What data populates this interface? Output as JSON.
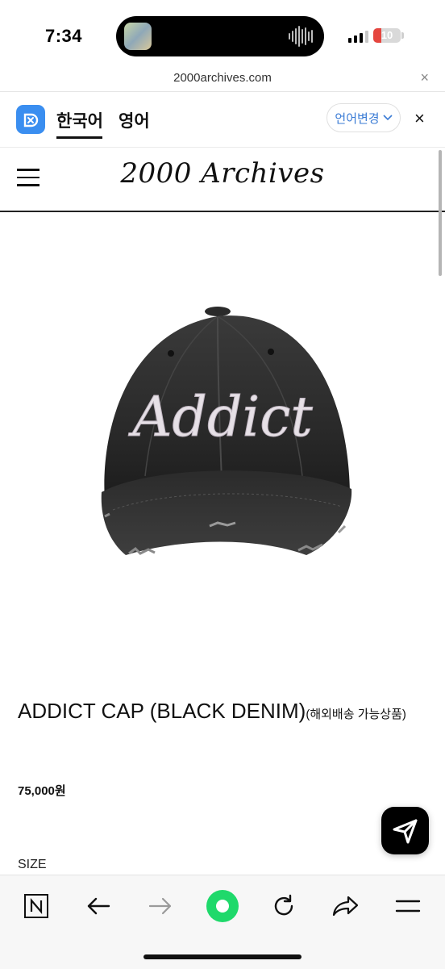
{
  "status_bar": {
    "time": "7:34",
    "battery_level": 10,
    "battery_label": "10"
  },
  "browser": {
    "url": "2000archives.com",
    "close_glyph": "×"
  },
  "translate_bar": {
    "tab_korean": "한국어",
    "tab_english": "영어",
    "change_language_label": "언어변경",
    "close_glyph": "×"
  },
  "site": {
    "logo_text": "2000 Archives"
  },
  "product": {
    "name": "ADDICT CAP (BLACK DENIM)",
    "shipping_note": "(해외배송 가능상품)",
    "price": "75,000원",
    "size_label": "SIZE",
    "cap_text": "Addict"
  },
  "toolbar": {
    "items": [
      "n-home-icon",
      "back-arrow-icon",
      "forward-arrow-icon",
      "green-dot-icon",
      "refresh-icon",
      "share-icon",
      "menu-icon"
    ]
  },
  "colors": {
    "accent_blue": "#3a8ef0",
    "lang_button_text": "#3a7bd5",
    "green_dot": "#1fd96b",
    "battery_red": "#e5463f"
  }
}
